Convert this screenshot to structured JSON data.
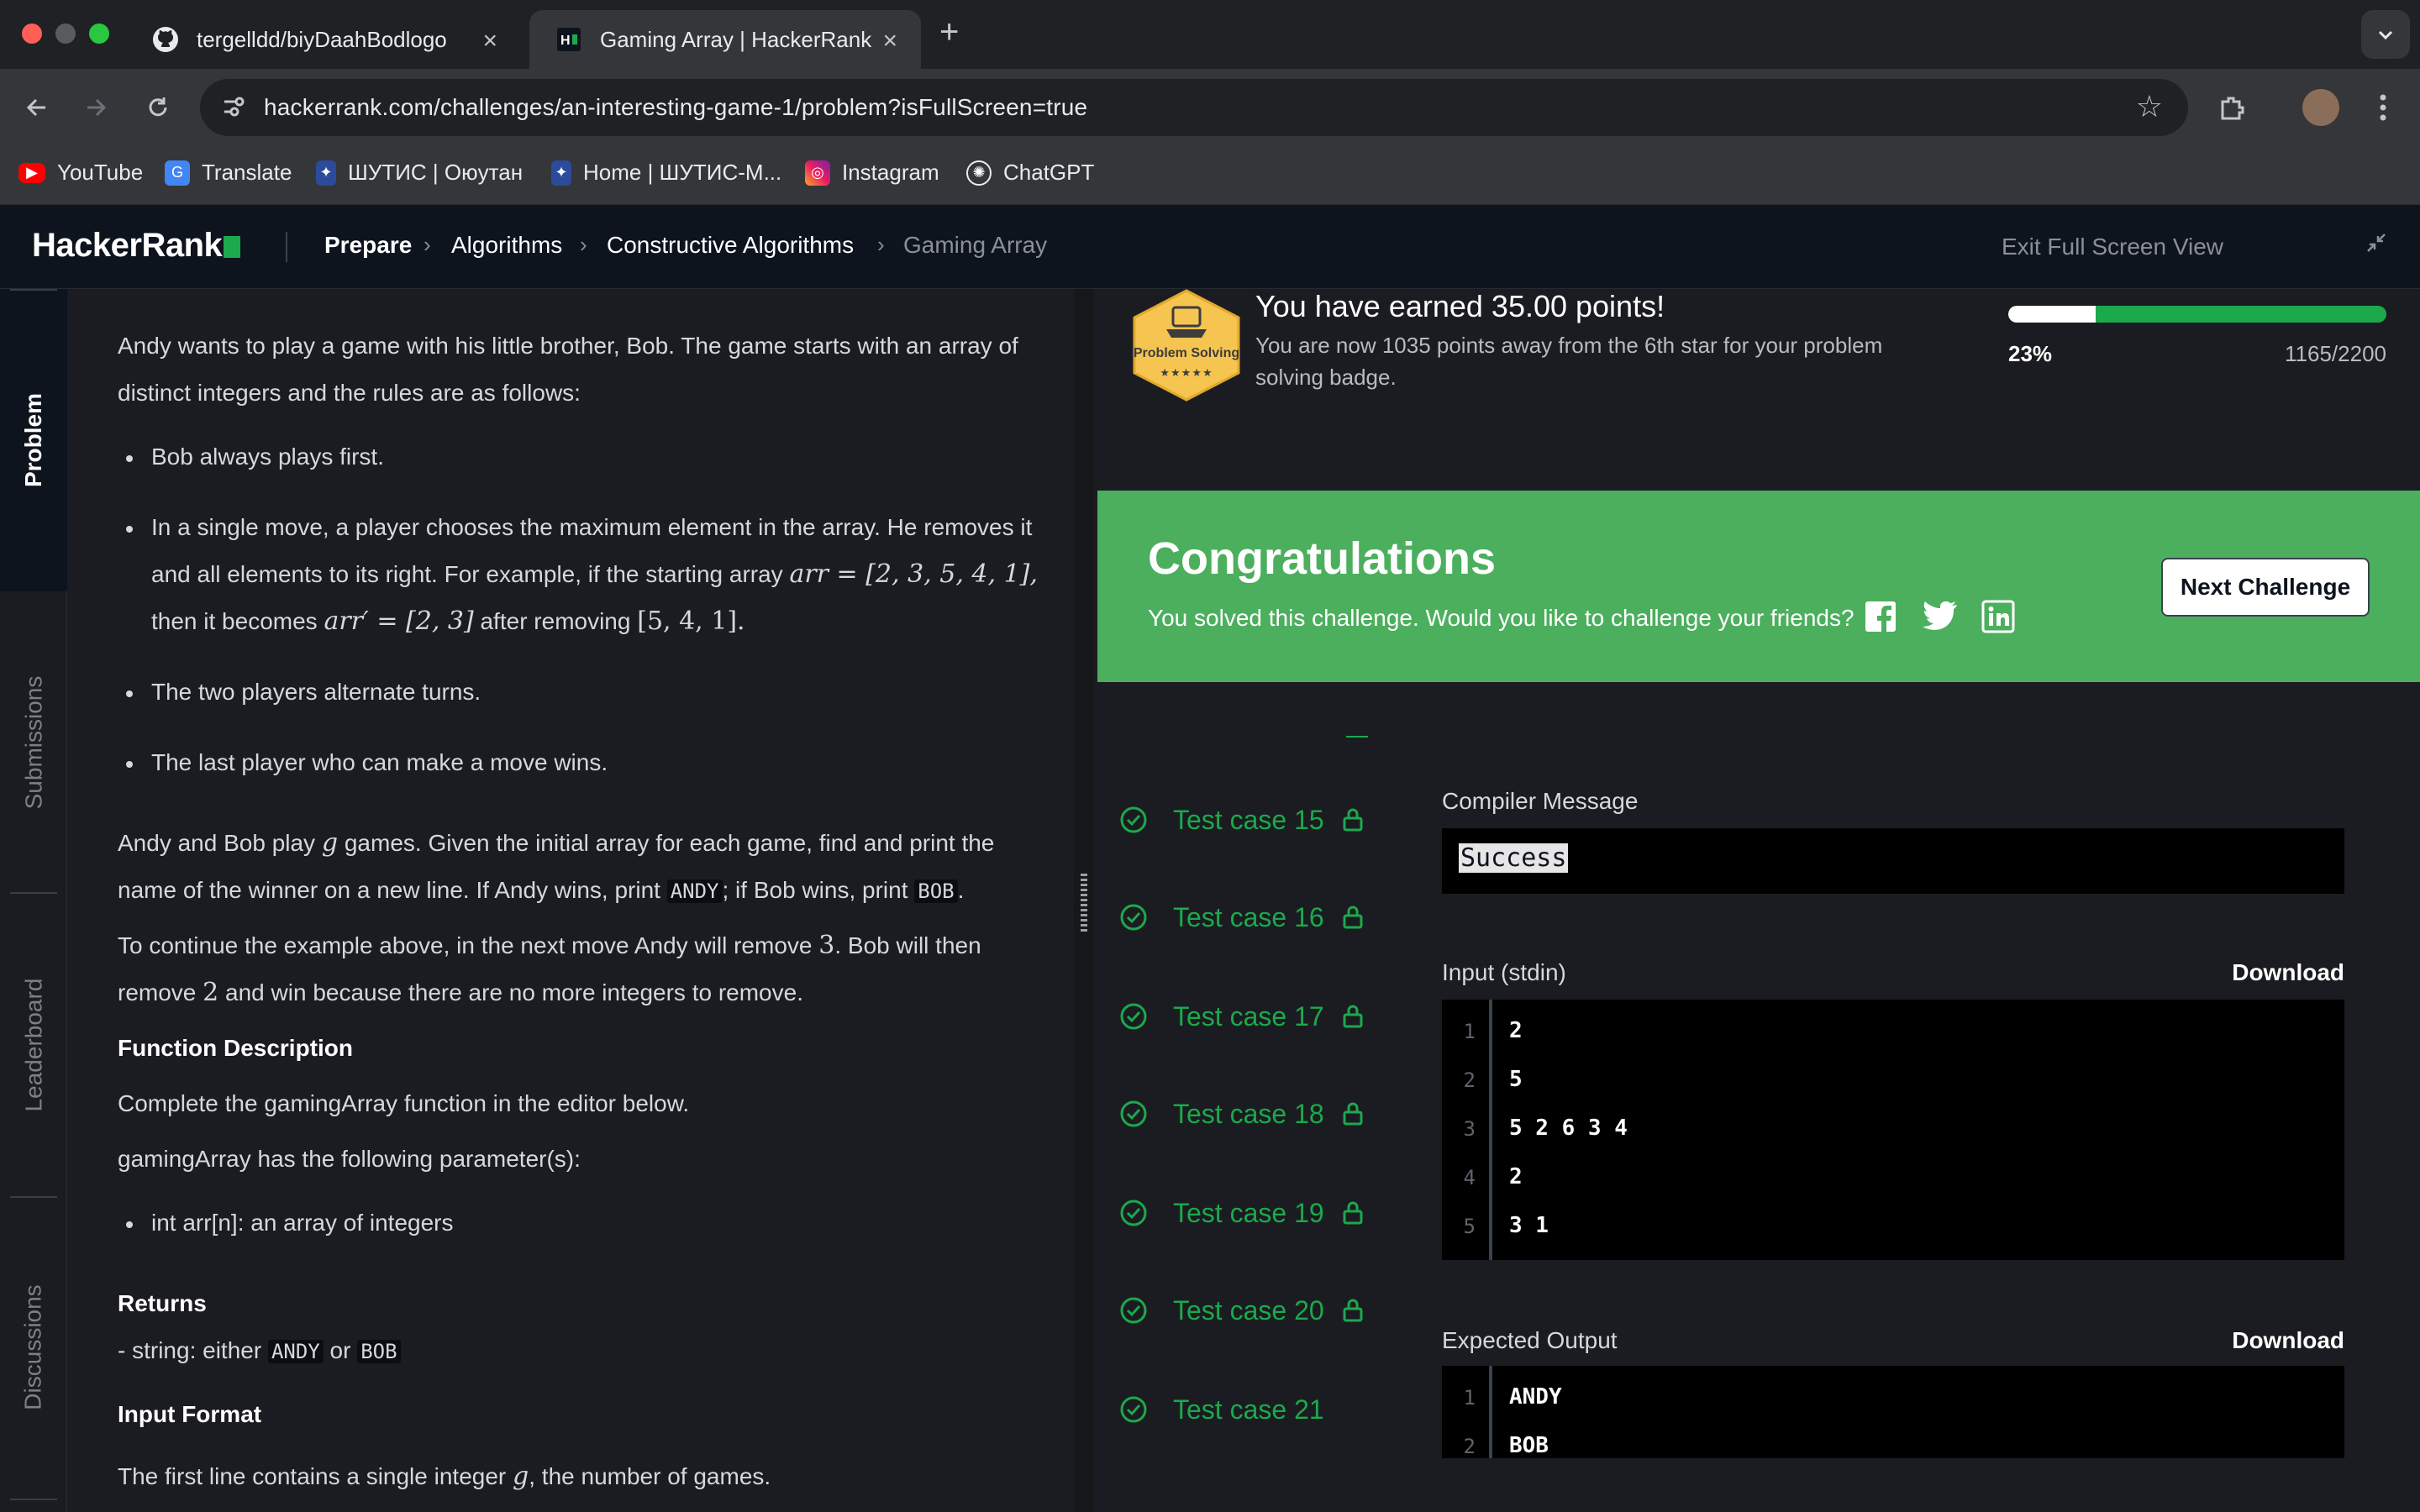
{
  "browser": {
    "tabs": [
      {
        "title": "tergelldd/biyDaahBodlogo",
        "icon": "github-icon"
      },
      {
        "title": "Gaming Array | HackerRank",
        "icon": "hackerrank-icon"
      }
    ],
    "url": "hackerrank.com/challenges/an-interesting-game-1/problem?isFullScreen=true",
    "bookmarks": [
      "YouTube",
      "Translate",
      "ШУТИС | Оюутан",
      "Home | ШУТИС-М...",
      "Instagram",
      "ChatGPT"
    ]
  },
  "header": {
    "logo": "HackerRank",
    "breadcrumbs": [
      "Prepare",
      "Algorithms",
      "Constructive Algorithms",
      "Gaming Array"
    ],
    "exit_fullscreen": "Exit Full Screen View"
  },
  "rail": {
    "problem": "Problem",
    "submissions": "Submissions",
    "leaderboard": "Leaderboard",
    "discussions": "Discussions"
  },
  "problem": {
    "intro1": "Andy wants to play a game with his little brother, Bob. The game starts with an array of",
    "intro2": "distinct integers and the rules are as follows:",
    "rule1": "Bob always plays first.",
    "rule2_a": "In a single move, a player chooses the maximum element in the array. He removes it",
    "rule2_b": "and all elements to its right. For example, if the starting array",
    "rule2_math1": "arr = [2, 3, 5, 4, 1],",
    "rule2_c": "then it becomes",
    "rule2_math2": "arr′ = [2, 3]",
    "rule2_d": "after removing",
    "rule2_math3": "[5, 4, 1].",
    "rule3": "The two players alternate turns.",
    "rule4": "The last player who can make a move wins.",
    "para1_a": "Andy and Bob play",
    "para1_g": "g",
    "para1_b": "games. Given the initial array for each game, find and print the",
    "para1_c": "name of the winner on a new line. If Andy wins, print",
    "andy": "ANDY",
    "para1_d": "; if Bob wins, print",
    "bob": "BOB",
    "para1_e": ".",
    "para2_a": "To continue the example above, in the next move Andy will remove",
    "para2_3": "3",
    "para2_b": ". Bob will then",
    "para2_c": "remove",
    "para2_2": "2",
    "para2_d": "and win because there are no more integers to remove.",
    "func_desc_head": "Function Description",
    "func_desc": "Complete the gamingArray function in the editor below.",
    "func_params": "gamingArray has the following parameter(s):",
    "param1": "int arr[n]: an array of integers",
    "returns_head": "Returns",
    "returns_a": "- string: either",
    "returns_or": "or",
    "input_head": "Input Format",
    "input_a": "The first line contains a single integer",
    "input_b": ", the number of games."
  },
  "points": {
    "badge_label": "Problem Solving",
    "badge_stars": "★★★★★",
    "title": "You have earned 35.00 points!",
    "subtitle": "You are now 1035 points away from the 6th star for your problem solving badge.",
    "progress_percent": 23,
    "progress_label": "23%",
    "points_label": "1165/2200"
  },
  "congrats": {
    "title": "Congratulations",
    "subtitle": "You solved this challenge. Would you like to challenge your friends?",
    "next_button": "Next Challenge"
  },
  "test_cases": [
    {
      "label": "Test case 15",
      "locked": true
    },
    {
      "label": "Test case 16",
      "locked": true
    },
    {
      "label": "Test case 17",
      "locked": true
    },
    {
      "label": "Test case 18",
      "locked": true
    },
    {
      "label": "Test case 19",
      "locked": true
    },
    {
      "label": "Test case 20",
      "locked": true
    },
    {
      "label": "Test case 21",
      "locked": false
    }
  ],
  "results": {
    "compiler_label": "Compiler Message",
    "compiler_message": "Success",
    "input_label": "Input (stdin)",
    "download": "Download",
    "input_lines": [
      "2",
      "5",
      "5 2 6 3 4",
      "2",
      "3 1"
    ],
    "expected_label": "Expected Output",
    "expected_lines": [
      "ANDY",
      "BOB"
    ]
  },
  "colors": {
    "accent_green": "#1ba94c",
    "banner_green": "#4caf5e",
    "header_bg": "#0e141e"
  }
}
